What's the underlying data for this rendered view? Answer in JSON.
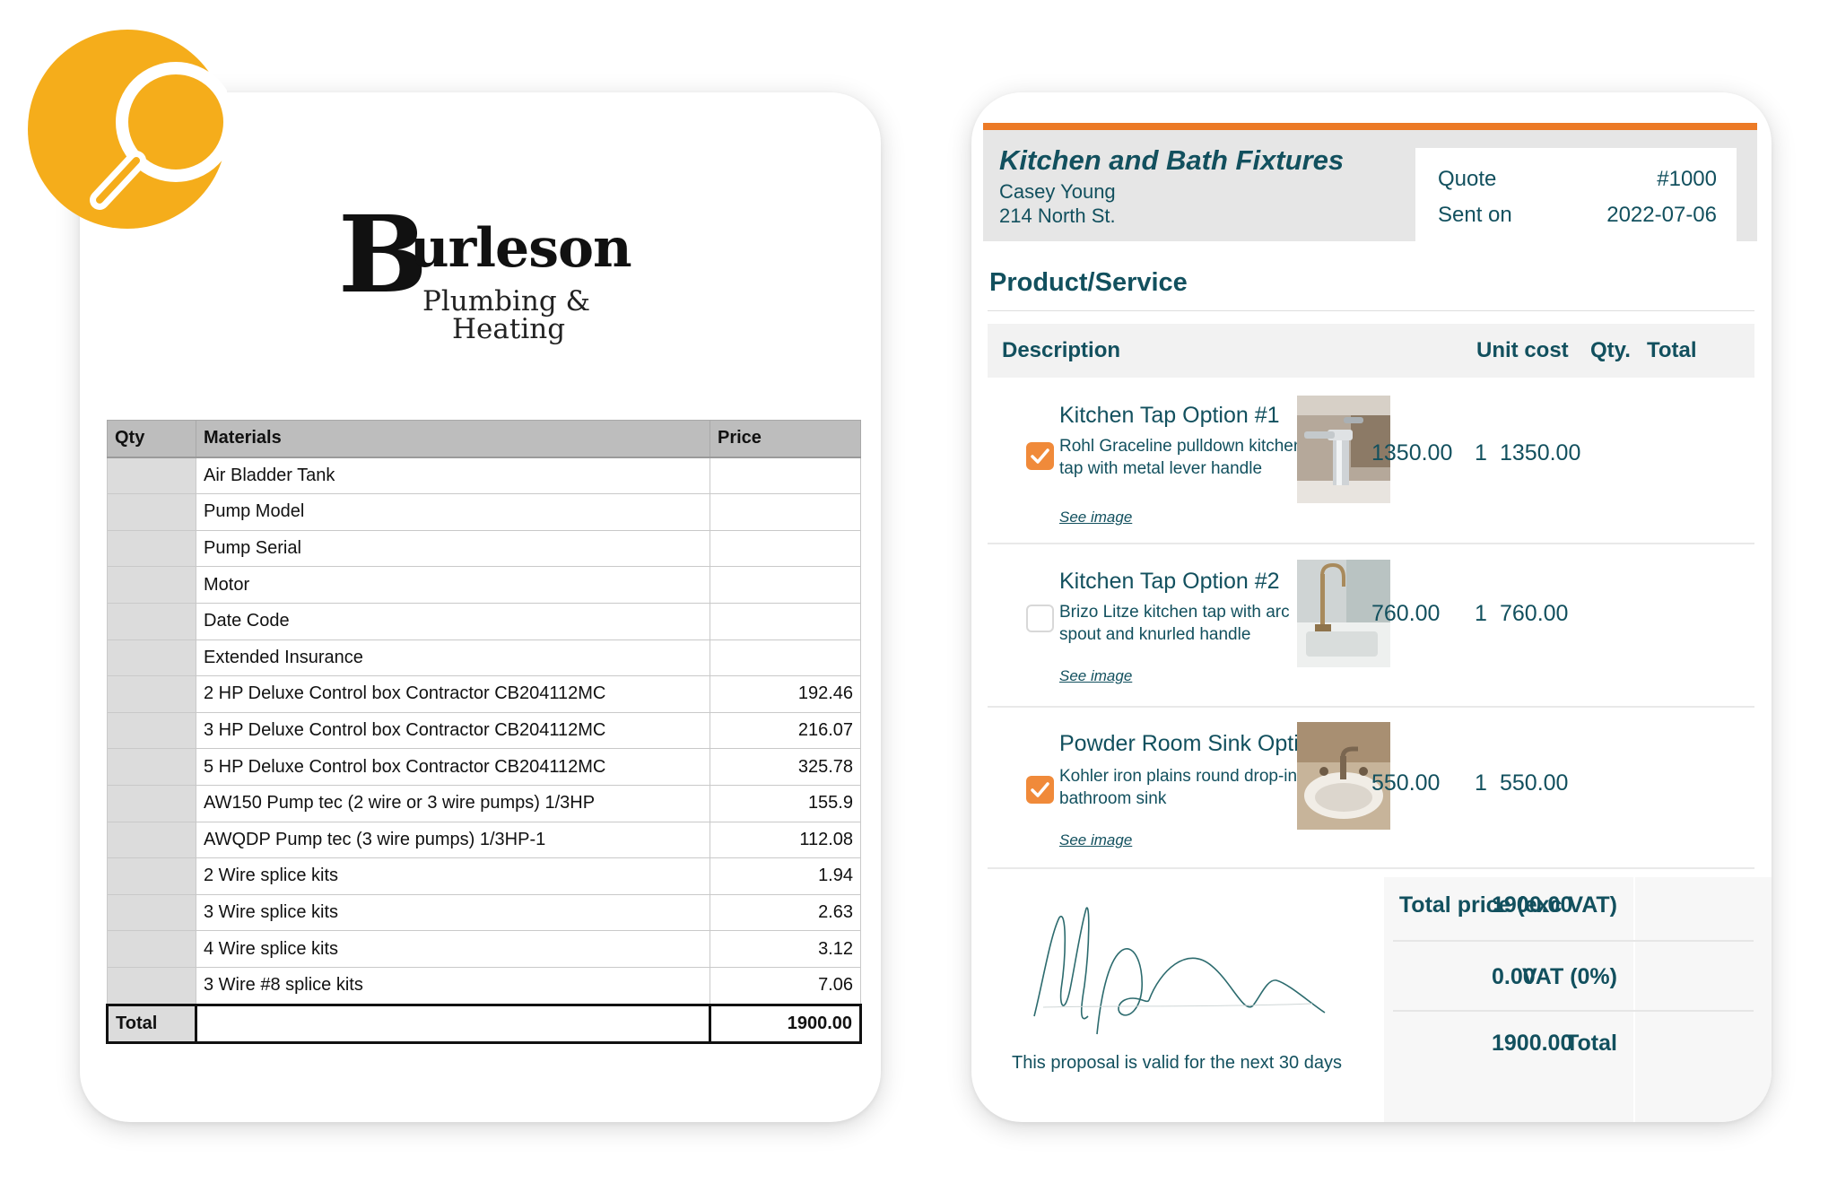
{
  "colors": {
    "brand_orange": "#ec7a26",
    "accent_teal": "#12505e",
    "badge_yellow": "#f5ad1b"
  },
  "badge": {
    "icon": "magnifier-icon"
  },
  "logo": {
    "initial": "B",
    "word": "urleson",
    "line1": "Plumbing &",
    "line2": "Heating"
  },
  "materials": {
    "headers": {
      "qty": "Qty",
      "materials": "Materials",
      "price": "Price"
    },
    "rows": [
      {
        "qty": "",
        "item": "Air Bladder Tank",
        "price": ""
      },
      {
        "qty": "",
        "item": "Pump Model",
        "price": ""
      },
      {
        "qty": "",
        "item": "Pump Serial",
        "price": ""
      },
      {
        "qty": "",
        "item": "Motor",
        "price": ""
      },
      {
        "qty": "",
        "item": "Date Code",
        "price": ""
      },
      {
        "qty": "",
        "item": "Extended Insurance",
        "price": ""
      },
      {
        "qty": "",
        "item": "2 HP Deluxe Control box Contractor CB204112MC",
        "price": "192.46"
      },
      {
        "qty": "",
        "item": "3 HP Deluxe Control box Contractor CB204112MC",
        "price": "216.07"
      },
      {
        "qty": "",
        "item": "5 HP Deluxe Control box Contractor CB204112MC",
        "price": "325.78"
      },
      {
        "qty": "",
        "item": "AW150 Pump tec (2 wire or 3 wire pumps) 1/3HP",
        "price": "155.9"
      },
      {
        "qty": "",
        "item": "AWQDP Pump tec (3 wire pumps) 1/3HP-1",
        "price": "112.08"
      },
      {
        "qty": "",
        "item": "2 Wire splice kits",
        "price": "1.94"
      },
      {
        "qty": "",
        "item": "3 Wire splice kits",
        "price": "2.63"
      },
      {
        "qty": "",
        "item": "4 Wire splice kits",
        "price": "3.12"
      },
      {
        "qty": "",
        "item": "3 Wire #8 splice kits",
        "price": "7.06"
      }
    ],
    "total_label": "Total",
    "total_value": "1900.00"
  },
  "quote": {
    "company": "Kitchen and Bath Fixtures",
    "client_name": "Casey Young",
    "client_address": "214 North St.",
    "quote_label": "Quote",
    "quote_number": "#1000",
    "sent_label": "Sent on",
    "sent_date": "2022-07-06",
    "section_title": "Product/Service",
    "columns": {
      "description": "Description",
      "unit_cost": "Unit cost",
      "qty": "Qty.",
      "total": "Total"
    },
    "items": [
      {
        "checked": true,
        "title": "Kitchen Tap Option #1",
        "description": "Rohl Graceline pulldown kitchen tap with metal lever handle",
        "link": "See image",
        "unit_cost": "1350.00",
        "qty": "1",
        "total": "1350.00",
        "image": "chrome-pulldown-tap"
      },
      {
        "checked": false,
        "title": "Kitchen Tap Option #2",
        "description": "Brizo Litze kitchen tap with arc spout and knurled handle",
        "link": "See image",
        "unit_cost": "760.00",
        "qty": "1",
        "total": "760.00",
        "image": "brass-arc-tap"
      },
      {
        "checked": true,
        "title": "Powder Room Sink Option #1",
        "description": "Kohler iron plains round drop-in bathroom sink",
        "link": "See image",
        "unit_cost": "550.00",
        "qty": "1",
        "total": "550.00",
        "image": "round-drop-in-sink"
      }
    ],
    "totals": {
      "subtotal_label": "Total price (exc VAT)",
      "subtotal": "1900.00",
      "vat_label": "VAT (0%)",
      "vat": "0.00",
      "total_label": "Total",
      "total": "1900.00"
    },
    "validity": "This proposal is valid for the next 30 days"
  }
}
